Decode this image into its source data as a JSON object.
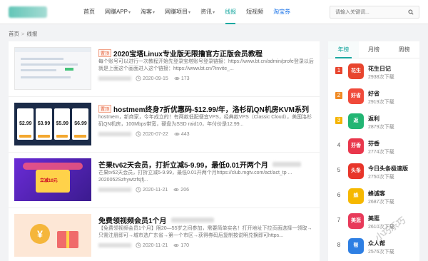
{
  "header": {
    "nav": [
      {
        "label": "首页",
        "dropdown": false,
        "state": "normal"
      },
      {
        "label": "网赚APP",
        "dropdown": true,
        "state": "normal"
      },
      {
        "label": "淘客",
        "dropdown": true,
        "state": "normal"
      },
      {
        "label": "网赚项目",
        "dropdown": true,
        "state": "normal"
      },
      {
        "label": "资讯",
        "dropdown": true,
        "state": "normal"
      },
      {
        "label": "线报",
        "dropdown": false,
        "state": "active"
      },
      {
        "label": "短视频",
        "dropdown": false,
        "state": "normal"
      },
      {
        "label": "淘宝券",
        "dropdown": false,
        "state": "hot"
      }
    ],
    "search_placeholder": "请输入关键词...",
    "accent_color": "#1aa8a0"
  },
  "breadcrumb": {
    "home": "首页",
    "current": "线报"
  },
  "articles": [
    {
      "tag": "置顶",
      "title": "2020宝塔Linux专业版无限撸官方正版会员教程",
      "desc": "每个账号可以进行一次教程开始先登录宝塔账号登录链接：https://www.bt.cn/admin/profe登录以后就是上面这个画面进入这个链接：https://www.bt.cn/?invite_...",
      "date": "2020-09-15",
      "views": "173"
    },
    {
      "tag": "置顶",
      "title": "hostmem终身7折优惠码-$12.99/年，洛杉矶QN机房KVM系列",
      "desc": "hostmem，新商家，今年成立的！有两款低配便宜VPS，经典款VPS（Classic Cloud），美国洛杉矶QN机房，100Mbps带宽，硬盘为SSD raid10，年付价是12.99...",
      "date": "2020-07-22",
      "views": "443"
    },
    {
      "tag": "",
      "title": "芒果tv62天会员，打折立减5-9.99，最低0.01开两个月",
      "desc": "芒果tv62天会员，打折立减5-9.99，最低0.01开两个月https://club.mgtv.com/act/act_tp ... 2020052Szhywtzfsjfj...",
      "date": "2020-11-21",
      "views": "206"
    },
    {
      "tag": "",
      "title": "免费领视频会员1个月",
      "desc": "【免费领视频会员1个月】限20—55岁之间参加，需要简单实名！打开地址下拉页面选择一领取→只需注册即可→城市选广东省→第一个市区→获得券码后复制按说明兑换即可https...",
      "date": "2020-11-21",
      "views": "170"
    }
  ],
  "sidebar": {
    "tabs": [
      "年榜",
      "月榜",
      "周榜"
    ],
    "active_tab": "年榜",
    "ranks": [
      {
        "rank": "1",
        "name": "花生日记",
        "downloads": "2938次下载",
        "icon": "peanut-diary-icon",
        "color": "#e8452e",
        "glyph": "花生"
      },
      {
        "rank": "2",
        "name": "好省",
        "downloads": "2919次下载",
        "icon": "haosheng-icon",
        "color": "#f04a3a",
        "glyph": "好省"
      },
      {
        "rank": "3",
        "name": "返利",
        "downloads": "2879次下载",
        "icon": "fanli-icon",
        "color": "#22b573",
        "glyph": "返"
      },
      {
        "rank": "4",
        "name": "芬香",
        "downloads": "2774次下载",
        "icon": "fenxiang-icon",
        "color": "#e9374c",
        "glyph": "芬香"
      },
      {
        "rank": "5",
        "name": "今日头条极速版",
        "downloads": "2750次下载",
        "icon": "toutiao-icon",
        "color": "#e8352a",
        "glyph": "头条"
      },
      {
        "rank": "6",
        "name": "蜂诚客",
        "downloads": "2687次下载",
        "icon": "bee-icon",
        "color": "#f6b800",
        "glyph": "蜂"
      },
      {
        "rank": "7",
        "name": "美逛",
        "downloads": "2610次下载",
        "icon": "meiguang-icon",
        "color": "#e83a5a",
        "glyph": "美逛"
      },
      {
        "rank": "8",
        "name": "众人帮",
        "downloads": "2576次下载",
        "icon": "zhongrenbang-icon",
        "color": "#2e7fe3",
        "glyph": "帮"
      }
    ]
  }
}
